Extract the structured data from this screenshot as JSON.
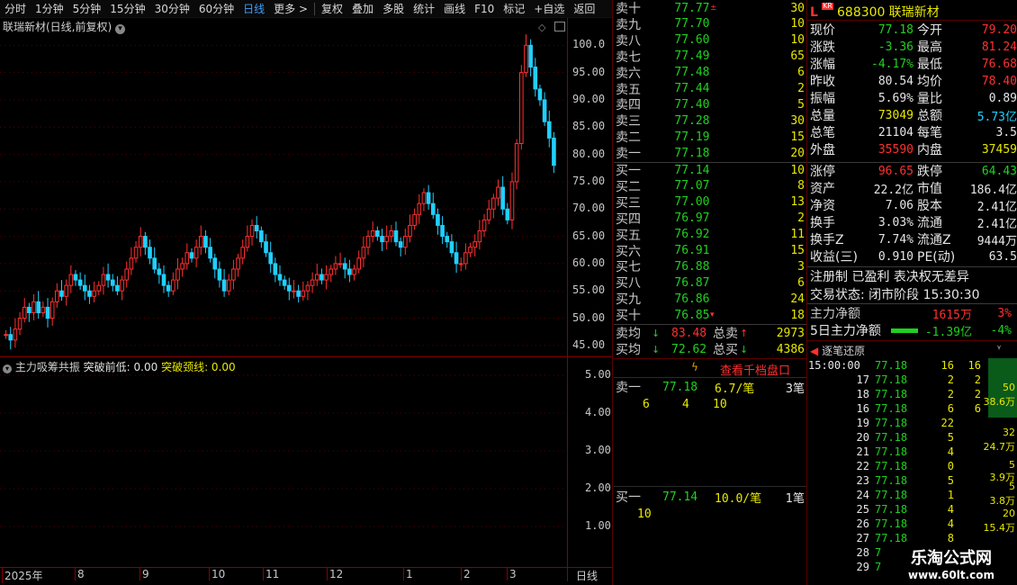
{
  "toolbar": {
    "periods": [
      "分时",
      "1分钟",
      "5分钟",
      "15分钟",
      "30分钟",
      "60分钟",
      "日线",
      "更多 >"
    ],
    "active": "日线",
    "tools": [
      "复权",
      "叠加",
      "多股",
      "统计",
      "画线",
      "F10",
      "标记",
      "+自选",
      "返回"
    ]
  },
  "chart": {
    "title": "联瑞新材(日线,前复权)",
    "ticks": [
      "100.0",
      "95.00",
      "90.00",
      "85.00",
      "80.00",
      "75.00",
      "70.00",
      "65.00",
      "60.00",
      "55.00",
      "50.00",
      "45.00"
    ],
    "indicator_title": "主力吸筹共振",
    "indicator_break_low": "突破前低: 0.00",
    "indicator_break_neck": "突破颈线: 0.00",
    "ind_ticks": [
      "5.00",
      "4.00",
      "3.00",
      "2.00",
      "1.00"
    ],
    "x_labels": [
      "2025年",
      "8",
      "9",
      "10",
      "11",
      "12",
      "1",
      "2",
      "3"
    ],
    "period_label": "日线"
  },
  "chart_data": {
    "type": "candlestick",
    "ylim": [
      43,
      105
    ],
    "series": [
      {
        "name": "",
        "values": [
          47,
          46,
          48,
          50,
          52,
          51,
          53,
          51,
          52,
          50,
          53,
          55,
          54,
          56,
          58,
          57,
          56,
          55,
          54,
          55,
          56,
          58,
          57,
          56,
          55,
          57,
          59,
          61,
          63,
          65,
          63,
          61,
          59,
          58,
          56,
          55,
          57,
          59,
          60,
          62,
          61,
          63,
          65,
          63,
          61,
          59,
          57,
          55,
          57,
          59,
          61,
          63,
          65,
          67,
          66,
          64,
          62,
          60,
          58,
          57,
          56,
          55,
          55,
          54,
          55,
          56,
          57,
          58,
          57,
          58,
          59,
          60,
          60,
          59,
          58,
          59,
          61,
          63,
          65,
          66,
          65,
          64,
          65,
          66,
          64,
          63,
          65,
          67,
          69,
          71,
          73,
          71,
          69,
          67,
          65,
          64,
          62,
          60,
          60,
          62,
          63,
          64,
          66,
          68,
          70,
          72,
          74,
          70,
          68,
          75,
          82,
          95,
          100,
          96,
          92,
          90,
          86,
          83,
          78
        ]
      }
    ]
  },
  "orderbook": {
    "sell": [
      {
        "label": "卖十",
        "price": "77.77",
        "mark": "±",
        "vol": "30"
      },
      {
        "label": "卖九",
        "price": "77.70",
        "vol": "10"
      },
      {
        "label": "卖八",
        "price": "77.60",
        "vol": "10"
      },
      {
        "label": "卖七",
        "price": "77.49",
        "vol": "65"
      },
      {
        "label": "卖六",
        "price": "77.48",
        "vol": "6"
      },
      {
        "label": "卖五",
        "price": "77.44",
        "vol": "2"
      },
      {
        "label": "卖四",
        "price": "77.40",
        "vol": "5"
      },
      {
        "label": "卖三",
        "price": "77.28",
        "vol": "30"
      },
      {
        "label": "卖二",
        "price": "77.19",
        "vol": "15"
      },
      {
        "label": "卖一",
        "price": "77.18",
        "vol": "20"
      }
    ],
    "buy": [
      {
        "label": "买一",
        "price": "77.14",
        "vol": "10"
      },
      {
        "label": "买二",
        "price": "77.07",
        "vol": "8"
      },
      {
        "label": "买三",
        "price": "77.00",
        "vol": "13"
      },
      {
        "label": "买四",
        "price": "76.97",
        "vol": "2"
      },
      {
        "label": "买五",
        "price": "76.92",
        "vol": "11"
      },
      {
        "label": "买六",
        "price": "76.91",
        "vol": "15"
      },
      {
        "label": "买七",
        "price": "76.88",
        "vol": "3"
      },
      {
        "label": "买八",
        "price": "76.87",
        "vol": "6"
      },
      {
        "label": "买九",
        "price": "76.86",
        "vol": "24"
      },
      {
        "label": "买十",
        "price": "76.85",
        "mark": "▾",
        "vol": "18"
      }
    ],
    "sell_avg_label": "卖均",
    "sell_avg": "83.48",
    "total_sell_label": "总卖",
    "total_sell": "2973",
    "buy_avg_label": "买均",
    "buy_avg": "72.62",
    "total_buy_label": "总买",
    "total_buy": "4386"
  },
  "thousand": {
    "link": "查看千档盘口",
    "sell_label": "卖一",
    "sell_price": "77.18",
    "sell_avg": "6.7/笔",
    "sell_count": "3笔",
    "sell_detail": [
      "6",
      "4",
      "10"
    ],
    "buy_label": "买一",
    "buy_price": "77.14",
    "buy_avg": "10.0/笔",
    "buy_count": "1笔",
    "buy_detail": [
      "10"
    ]
  },
  "quote": {
    "code": "688300",
    "name": "联瑞新材",
    "badge_l": "L",
    "badge_kr": "KR",
    "rows": [
      [
        "现价",
        "77.18",
        "今开",
        "79.20"
      ],
      [
        "涨跌",
        "-3.36",
        "最高",
        "81.24"
      ],
      [
        "涨幅",
        "-4.17%",
        "最低",
        "76.68"
      ],
      [
        "昨收",
        "80.54",
        "均价",
        "78.40"
      ],
      [
        "振幅",
        "5.69%",
        "量比",
        "0.89"
      ],
      [
        "总量",
        "73049",
        "总额",
        "5.73亿"
      ],
      [
        "总笔",
        "21104",
        "每笔",
        "3.5"
      ],
      [
        "外盘",
        "35590",
        "内盘",
        "37459"
      ]
    ],
    "rows2": [
      [
        "涨停",
        "96.65",
        "跌停",
        "64.43"
      ],
      [
        "资产",
        "22.2亿",
        "市值",
        "186.4亿"
      ],
      [
        "净资",
        "7.06",
        "股本",
        "2.41亿"
      ],
      [
        "换手",
        "3.03%",
        "流通",
        "2.41亿"
      ],
      [
        "换手Z",
        "7.74%",
        "流通Z",
        "9444万"
      ],
      [
        "收益(三)",
        "0.910",
        "PE(动)",
        "63.5"
      ]
    ],
    "reg": "注册制 已盈利 表决权无差异",
    "trade_status": "交易状态: 闭市阶段 15:30:30",
    "main_net_label": "主力净额",
    "main_net": "1615万",
    "main_net_pct": "3%",
    "five_day_label": "5日主力净额",
    "five_day": "-1.39亿",
    "five_day_pct": "-4%"
  },
  "ticks": {
    "title": "逐笔还原",
    "rows": [
      [
        "15:00:00",
        "77.18",
        "16",
        "16"
      ],
      [
        "17",
        "77.18",
        "2",
        "2"
      ],
      [
        "18",
        "77.18",
        "2",
        "2"
      ],
      [
        "16",
        "77.18",
        "6",
        "6"
      ],
      [
        "19",
        "77.18",
        "22",
        ""
      ],
      [
        "20",
        "77.18",
        "5",
        ""
      ],
      [
        "21",
        "77.18",
        "4",
        ""
      ],
      [
        "22",
        "77.18",
        "0",
        ""
      ],
      [
        "23",
        "77.18",
        "5",
        ""
      ],
      [
        "24",
        "77.18",
        "1",
        ""
      ],
      [
        "25",
        "77.18",
        "4",
        ""
      ],
      [
        "26",
        "77.18",
        "4",
        ""
      ],
      [
        "27",
        "77.18",
        "8",
        ""
      ],
      [
        "28",
        "7",
        "",
        ""
      ],
      [
        "29",
        "7",
        "",
        ""
      ]
    ],
    "side": [
      "50",
      "38.6万",
      "32",
      "24.7万",
      "5",
      "3.9万",
      "5",
      "3.8万",
      "20",
      "15.4万"
    ]
  },
  "watermark": {
    "title": "乐淘公式网",
    "url": "www.60lt.com"
  }
}
